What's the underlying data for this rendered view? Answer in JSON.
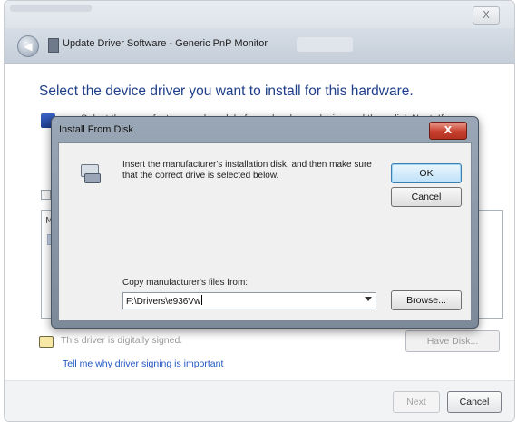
{
  "outer_window": {
    "title": "Update Driver Software - Generic PnP Monitor",
    "close_glyph": "X",
    "heading": "Select the device driver you want to install for this hardware.",
    "instruction_partial": "Select the manufacturer and model of your hardware device and then click Next. If you",
    "unsigned_text": "This driver is digitally signed.",
    "have_disk_label": "Have Disk...",
    "signing_link": "Tell me why driver signing is important",
    "next_label": "Next",
    "cancel_label": "Cancel"
  },
  "dialog": {
    "title": "Install From Disk",
    "close_glyph": "X",
    "message": "Insert the manufacturer's installation disk, and then make sure that the correct drive is selected below.",
    "ok_label": "OK",
    "cancel_label": "Cancel",
    "copy_label": "Copy manufacturer's files from:",
    "path_value": "F:\\Drivers\\e936Vw",
    "browse_label": "Browse..."
  }
}
